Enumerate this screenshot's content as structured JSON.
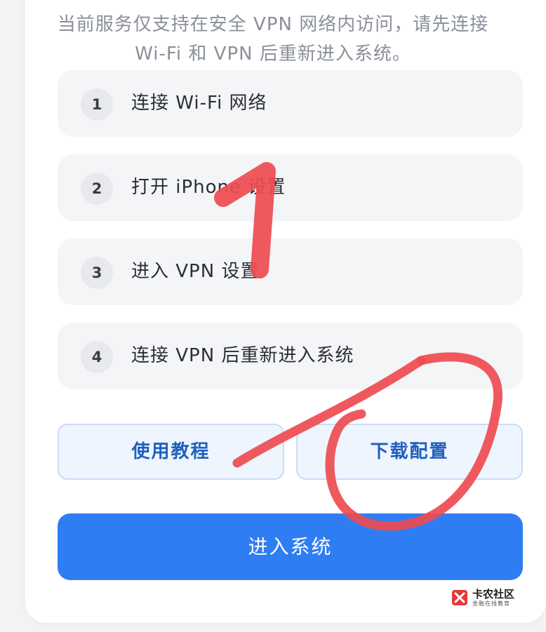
{
  "notice": {
    "line1": "当前服务仅支持在安全 VPN 网络内访问，请先连接",
    "line2": "Wi-Fi 和 VPN 后重新进入系统。"
  },
  "steps": [
    {
      "num": "1",
      "text": "连接 Wi-Fi 网络"
    },
    {
      "num": "2",
      "text": "打开 iPhone 设置"
    },
    {
      "num": "3",
      "text": "进入 VPN 设置"
    },
    {
      "num": "4",
      "text": "连接 VPN 后重新进入系统"
    }
  ],
  "buttons": {
    "tutorial": "使用教程",
    "download": "下载配置",
    "enter": "进入系统"
  },
  "annotation": {
    "digit": "1",
    "color": "#ee4b50"
  },
  "watermark": {
    "title": "卡农社区",
    "subtitle": "金融在线教育"
  },
  "colors": {
    "primary": "#2f7df2",
    "secondary_bg": "#eef5ff",
    "secondary_text": "#1f5fbd"
  }
}
